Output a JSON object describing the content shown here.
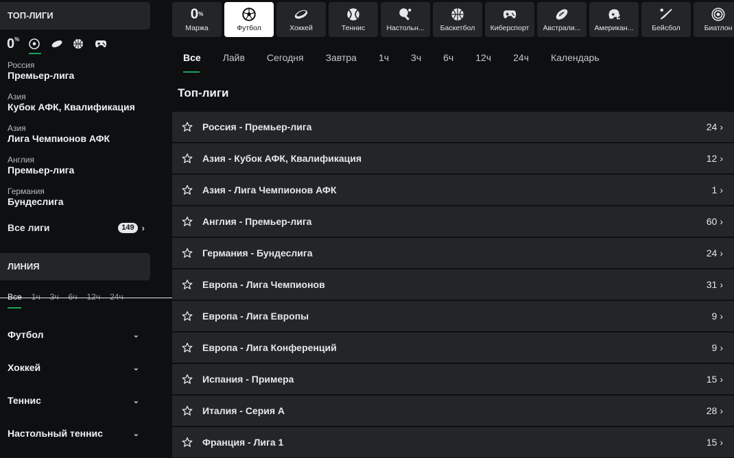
{
  "sidebar": {
    "top_title": "ТОП-ЛИГИ",
    "marja_value": "0",
    "marja_unit": "%",
    "leagues": [
      {
        "country": "Россия",
        "name": "Премьер-лига"
      },
      {
        "country": "Азия",
        "name": "Кубок АФК, Квалификация"
      },
      {
        "country": "Азия",
        "name": "Лига Чемпионов АФК"
      },
      {
        "country": "Англия",
        "name": "Премьер-лига"
      },
      {
        "country": "Германия",
        "name": "Бундеслига"
      }
    ],
    "all_leagues_label": "Все лиги",
    "all_leagues_count": "149",
    "line_title": "ЛИНИЯ",
    "line_tabs": [
      "Все",
      "1ч",
      "3ч",
      "6ч",
      "12ч",
      "24ч"
    ],
    "sports": [
      "Футбол",
      "Хоккей",
      "Теннис",
      "Настольный теннис"
    ]
  },
  "tiles": {
    "marja_value": "0",
    "marja_unit": "%",
    "marja_label": "Маржа",
    "items": [
      {
        "label": "Футбол",
        "icon": "soccer-ball-icon"
      },
      {
        "label": "Хоккей",
        "icon": "hockey-puck-icon"
      },
      {
        "label": "Теннис",
        "icon": "tennis-ball-icon"
      },
      {
        "label": "Настольн...",
        "icon": "table-tennis-icon"
      },
      {
        "label": "Баскетбол",
        "icon": "basketball-icon"
      },
      {
        "label": "Киберспорт",
        "icon": "gamepad-icon"
      },
      {
        "label": "Австрали...",
        "icon": "rugby-ball-icon"
      },
      {
        "label": "Американ...",
        "icon": "football-helmet-icon"
      },
      {
        "label": "Бейсбол",
        "icon": "baseball-bat-icon"
      },
      {
        "label": "Биатлон",
        "icon": "target-icon"
      }
    ]
  },
  "tabs": [
    "Все",
    "Лайв",
    "Сегодня",
    "Завтра",
    "1ч",
    "3ч",
    "6ч",
    "12ч",
    "24ч",
    "Календарь"
  ],
  "main_title": "Топ-лиги",
  "list": [
    {
      "name": "Россия - Премьер-лига",
      "count": "24"
    },
    {
      "name": "Азия - Кубок АФК, Квалификация",
      "count": "12"
    },
    {
      "name": "Азия - Лига Чемпионов АФК",
      "count": "1"
    },
    {
      "name": "Англия - Премьер-лига",
      "count": "60"
    },
    {
      "name": "Германия - Бундеслига",
      "count": "24"
    },
    {
      "name": "Европа - Лига Чемпионов",
      "count": "31"
    },
    {
      "name": "Европа - Лига Европы",
      "count": "9"
    },
    {
      "name": "Европа - Лига Конференций",
      "count": "9"
    },
    {
      "name": "Испания - Примера",
      "count": "15"
    },
    {
      "name": "Италия - Серия А",
      "count": "28"
    },
    {
      "name": "Франция - Лига 1",
      "count": "15"
    }
  ],
  "colors": {
    "accent": "#1aa35a",
    "panel": "#232529",
    "background": "#0e0f11"
  }
}
